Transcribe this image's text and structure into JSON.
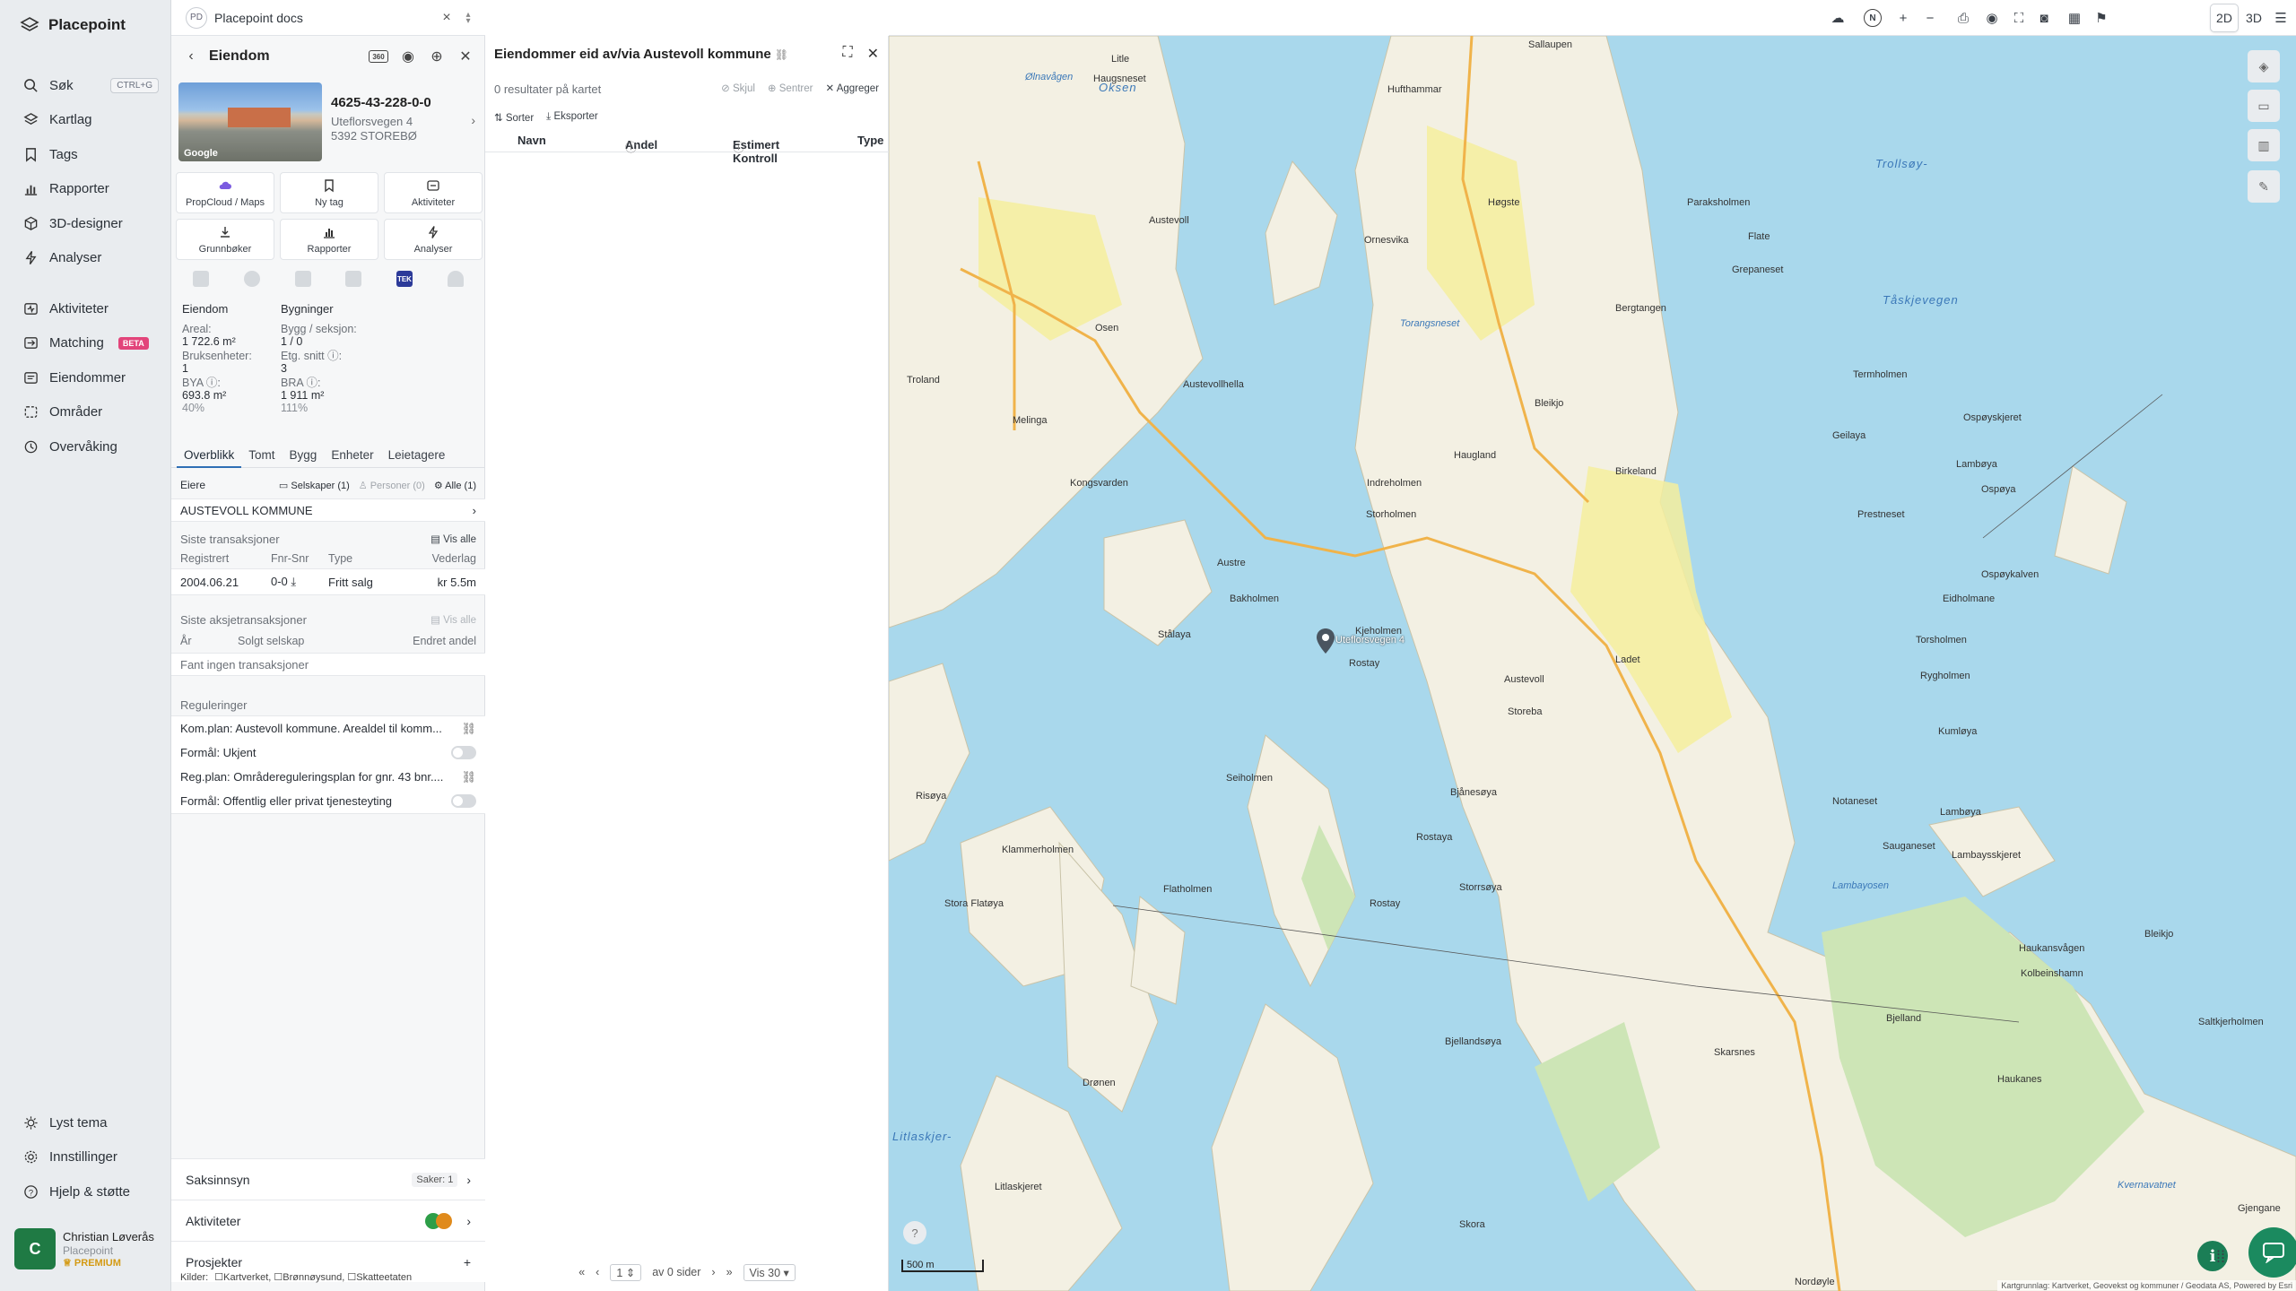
{
  "app": {
    "name": "Placepoint"
  },
  "nav": {
    "items": [
      {
        "label": "Søk",
        "shortcut": "CTRL+G"
      },
      {
        "label": "Kartlag"
      },
      {
        "label": "Tags"
      },
      {
        "label": "Rapporter"
      },
      {
        "label": "3D-designer"
      },
      {
        "label": "Analyser"
      },
      {
        "label": "Aktiviteter"
      },
      {
        "label": "Matching",
        "badge": "BETA"
      },
      {
        "label": "Eiendommer"
      },
      {
        "label": "Områder"
      },
      {
        "label": "Overvåking"
      }
    ],
    "bottom": [
      {
        "label": "Lyst tema"
      },
      {
        "label": "Innstillinger"
      },
      {
        "label": "Hjelp & støtte"
      }
    ],
    "user": {
      "initial": "C",
      "name": "Christian Løverås",
      "org": "Placepoint",
      "plan": "PREMIUM"
    }
  },
  "tab": {
    "badge": "PD",
    "title": "Placepoint docs"
  },
  "property": {
    "header": "Eiendom",
    "badge_360": "360",
    "photo_credit": "Google",
    "id": "4625-43-228-0-0",
    "street": "Uteflorsvegen 4",
    "postal": "5392 STOREBØ",
    "actions": [
      "PropCloud / Maps",
      "Ny tag",
      "Aktiviteter",
      "Grunnbøker",
      "Rapporter",
      "Analyser"
    ],
    "layer_tek": "TEK",
    "stats": {
      "col1_head": "Eiendom",
      "col2_head": "Bygninger",
      "areal_label": "Areal:",
      "areal_value": "1 722.6 m²",
      "bygg_label": "Bygg / seksjon:",
      "bygg_value": "1 / 0",
      "bruk_label": "Bruksenheter:",
      "bruk_value": "1",
      "etg_label": "Etg. snitt ⓘ:",
      "etg_value": "3",
      "bya_label": "BYA ⓘ:",
      "bya_value": "693.8 m²",
      "bya_pct": "40%",
      "bra_label": "BRA ⓘ:",
      "bra_value": "1 911 m²",
      "bra_pct": "111%"
    },
    "subtabs": [
      "Overblikk",
      "Tomt",
      "Bygg",
      "Enheter",
      "Leietagere"
    ],
    "owners": {
      "label": "Eiere",
      "filter_companies": "Selskaper (1)",
      "filter_persons": "Personer (0)",
      "filter_all": "Alle (1)",
      "owner_name": "AUSTEVOLL KOMMUNE"
    },
    "transactions": {
      "title": "Siste transaksjoner",
      "view_all": "Vis alle",
      "headers": [
        "Registrert",
        "Fnr-Snr",
        "Type",
        "Vederlag"
      ],
      "rows": [
        {
          "registrert": "2004.06.21",
          "fnr": "0-0",
          "type": "Fritt salg",
          "vederlag": "kr 5.5m"
        }
      ]
    },
    "share_transactions": {
      "title": "Siste aksjetransaksjoner",
      "view_all": "Vis alle",
      "headers": [
        "År",
        "Solgt selskap",
        "Endret andel"
      ],
      "empty": "Fant ingen transaksjoner"
    },
    "regulations": {
      "title": "Reguleringer",
      "items": [
        {
          "text": "Kom.plan: Austevoll kommune. Arealdel til komm...",
          "kind": "link"
        },
        {
          "text": "Formål: Ukjent",
          "kind": "toggle"
        },
        {
          "text": "Reg.plan: Områdereguleringsplan for gnr. 43 bnr....",
          "kind": "link"
        },
        {
          "text": "Formål: Offentlig eller privat tjenesteyting",
          "kind": "toggle"
        }
      ]
    },
    "footer": {
      "saksinnsyn": "Saksinnsyn",
      "saker": "Saker: 1",
      "aktiviteter": "Aktiviteter",
      "prosjekter": "Prosjekter",
      "sources_label": "Kilder:",
      "sources": [
        "Kartverket",
        "Brønnøysund",
        "Skatteetaten"
      ]
    }
  },
  "owned": {
    "title": "Eiendommer eid av/via Austevoll kommune",
    "results": "0 resultater på kartet",
    "tools": [
      "Skjul",
      "Sentrer",
      "Aggreger"
    ],
    "buttons": [
      "Sorter",
      "Eksporter"
    ],
    "columns": [
      "Navn",
      "Andel",
      "Estimert Kontroll",
      "Type"
    ],
    "pager": {
      "page": "1",
      "of_pages": "av 0 sider",
      "per_page": "Vis 30"
    }
  },
  "map": {
    "mode_2d": "2D",
    "mode_3d": "3D",
    "compass": "N",
    "scale": "500 m",
    "attribution": "Kartgrunnlag: Kartverket, Geovekst og kommuner / Geodata AS, Powered by Esri",
    "marker_label": "Uteflorsvegen 4",
    "labels": [
      "Litle",
      "Hufthammar",
      "Sallaupen",
      "Ølnavågen",
      "Haugsneset",
      "Oksen",
      "Trollsøy-",
      "Storholmen",
      "Hufthammar",
      "Høgste",
      "Paraksholmen",
      "Flate",
      "Grepaneset",
      "Bergtangen",
      "Ornesvika",
      "Torangsneset",
      "Tåskjevegen",
      "Austevoll",
      "Osen",
      "Termholmen",
      "Bleikjo",
      "Ospøyskjeret",
      "Geilaya",
      "Lambøya",
      "Haugland",
      "Birkeland",
      "Ospøya",
      "Prestneset",
      "Troland",
      "Austevollhella",
      "Melinga",
      "Kongsvarden",
      "Indreholmen",
      "Storholmen",
      "Indreholmen",
      "Ospøykalven",
      "Eidholmane",
      "Austre",
      "Bakholmen",
      "Stålaya",
      "Kjeholmen",
      "Rostay",
      "Austevoll",
      "Storeba",
      "Ladet",
      "Torsholmen",
      "Rygholmen",
      "Kumløya",
      "Bjånesøya",
      "Notaneset",
      "Lambøya",
      "Sauganeset",
      "Lambaysskjeret",
      "Lambayosen",
      "Stora Flatøya",
      "Klammerholmen",
      "Flatholmen",
      "Seiholmen",
      "Risøya",
      "Rostaya",
      "Storrsøya",
      "Rostay",
      "Haukansvågen",
      "Kolbeinshamn",
      "Bleikjo",
      "Drønen",
      "Bjellandsøya",
      "Haukanes",
      "Saltkjerholmen",
      "Litlaskjer-",
      "Litlaskjeret",
      "Skora",
      "Gjengane",
      "Nordøyle",
      "Kvernavatnet",
      "Bjelland",
      "Skarsnes"
    ]
  },
  "colors": {
    "accent": "#2f6fb5",
    "beta": "#e2447a",
    "premium": "#d49a13",
    "water": "#a9d8ec",
    "land": "#f4f1e6",
    "forest": "#cde5b6",
    "chat": "#1b8a5f"
  }
}
